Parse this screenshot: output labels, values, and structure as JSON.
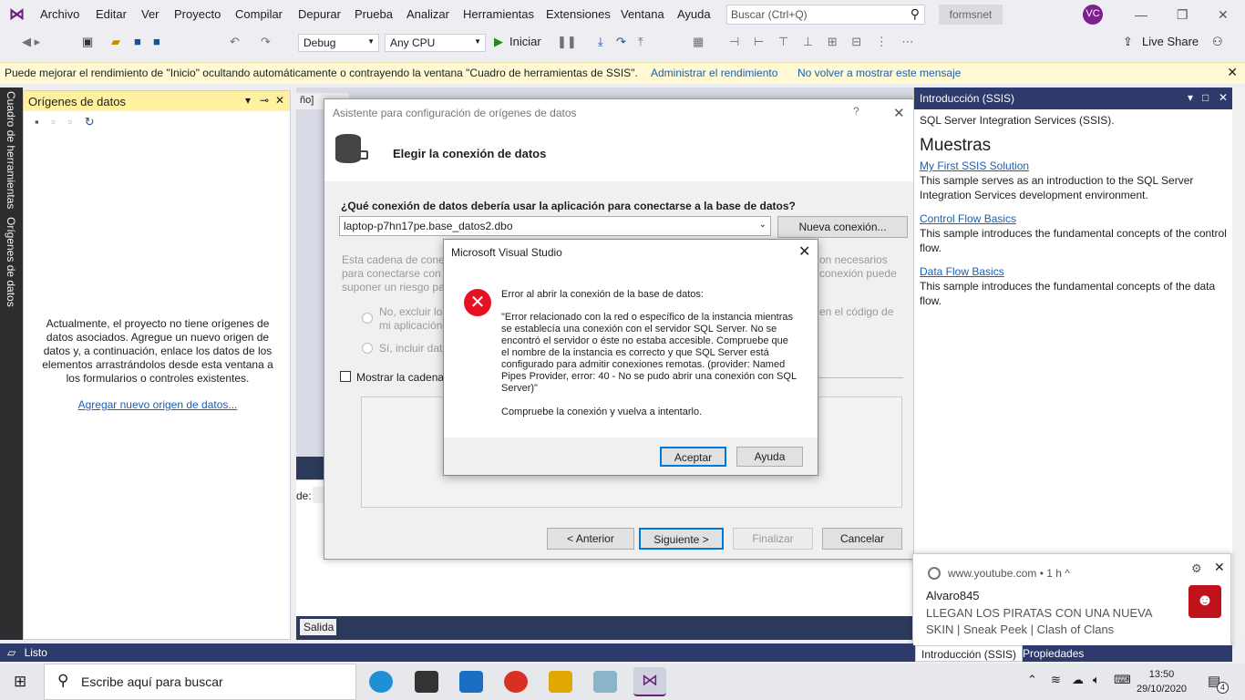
{
  "menu": {
    "items": [
      "Archivo",
      "Editar",
      "Ver",
      "Proyecto",
      "Compilar",
      "Depurar",
      "Prueba",
      "Analizar",
      "Herramientas",
      "Extensiones",
      "Ventana",
      "Ayuda"
    ],
    "search_placeholder": "Buscar (Ctrl+Q)",
    "solution_name": "formsnet",
    "user_initials": "VC"
  },
  "toolbar": {
    "config": "Debug",
    "platform": "Any CPU",
    "start_label": "Iniciar",
    "live_share": "Live Share"
  },
  "infobar": {
    "message": "Puede mejorar el rendimiento de \"Inicio\" ocultando automáticamente o contrayendo la ventana \"Cuadro de herramientas de SSIS\".",
    "link1": "Administrar el rendimiento",
    "link2": "No volver a mostrar este mensaje"
  },
  "left_strip": {
    "toolbox": "Cuadro de herramientas",
    "datasources": "Orígenes de datos"
  },
  "datasources": {
    "title": "Orígenes de datos",
    "message": "Actualmente, el proyecto no tiene orígenes de datos asociados. Agregue un nuevo origen de datos y, a continuación, enlace los datos de los elementos arrastrándolos desde esta ventana a los formularios o controles existentes.",
    "add_link": "Agregar nuevo origen de datos..."
  },
  "editor": {
    "doc_tab": "ño]",
    "partial_label": "de:",
    "output_tab": "Salida"
  },
  "wizard": {
    "title": "Asistente para configuración de orígenes de datos",
    "help": "?",
    "heading": "Elegir la conexión de datos",
    "question": "¿Qué conexión de datos debería usar la aplicación para conectarse a la base de datos?",
    "connection": "laptop-p7hn17pe.base_datos2.dbo",
    "new_connection": "Nueva conexión...",
    "info_left": "Esta cadena de conex\npara conectarse con l\nsuponer un riesgo pa",
    "info_right": "on necesarios\nconexión puede",
    "radio1_left": "No, excluir los\nmi aplicación",
    "radio1_right": "en el código de",
    "radio2": "Sí, incluir dato",
    "show_string": "Mostrar la cadena",
    "back": "< Anterior",
    "next": "Siguiente >",
    "finish": "Finalizar",
    "cancel": "Cancelar"
  },
  "error_dialog": {
    "title": "Microsoft Visual Studio",
    "headline": "Error al abrir la conexión de la base de datos:",
    "detail": "\"Error relacionado con la red o específico de la instancia mientras se establecía una conexión con el servidor SQL Server. No se encontró el servidor o éste no estaba accesible. Compruebe que el nombre de la instancia es correcto y que SQL Server está configurado para admitir conexiones remotas. (provider: Named Pipes Provider, error: 40 - No se pudo abrir una conexión con SQL Server)\"",
    "hint": "Compruebe la conexión y vuelva a intentarlo.",
    "ok": "Aceptar",
    "help": "Ayuda"
  },
  "intro": {
    "title": "Introducción (SSIS)",
    "top_text": "SQL Server Integration Services (SSIS).",
    "section": "Muestras",
    "samples": [
      {
        "link": "My First SSIS Solution",
        "desc": "This sample serves as an introduction to the SQL Server Integration Services development environment."
      },
      {
        "link": "Control Flow Basics",
        "desc": "This sample introduces the fundamental concepts of the control flow."
      },
      {
        "link": "Data Flow Basics",
        "desc": "This sample introduces the fundamental concepts of the data flow."
      }
    ]
  },
  "notification": {
    "source": "www.youtube.com",
    "age": "• 1 h ^",
    "author": "Alvaro845",
    "text": "LLEGAN LOS PIRATAS CON UNA NUEVA SKIN | Sneak Peek | Clash of Clans"
  },
  "bottom_tabs": [
    "Introducción (SSIS)",
    "Propiedades"
  ],
  "status": "Listo",
  "taskbar": {
    "search": "Escribe aquí para buscar",
    "time": "13:50",
    "date": "29/10/2020",
    "notifications": "4"
  },
  "colors": {
    "vs_purple": "#68217a",
    "accent_blue": "#0078d7",
    "error_red": "#e81123",
    "info_yellow": "#fff9d4"
  }
}
